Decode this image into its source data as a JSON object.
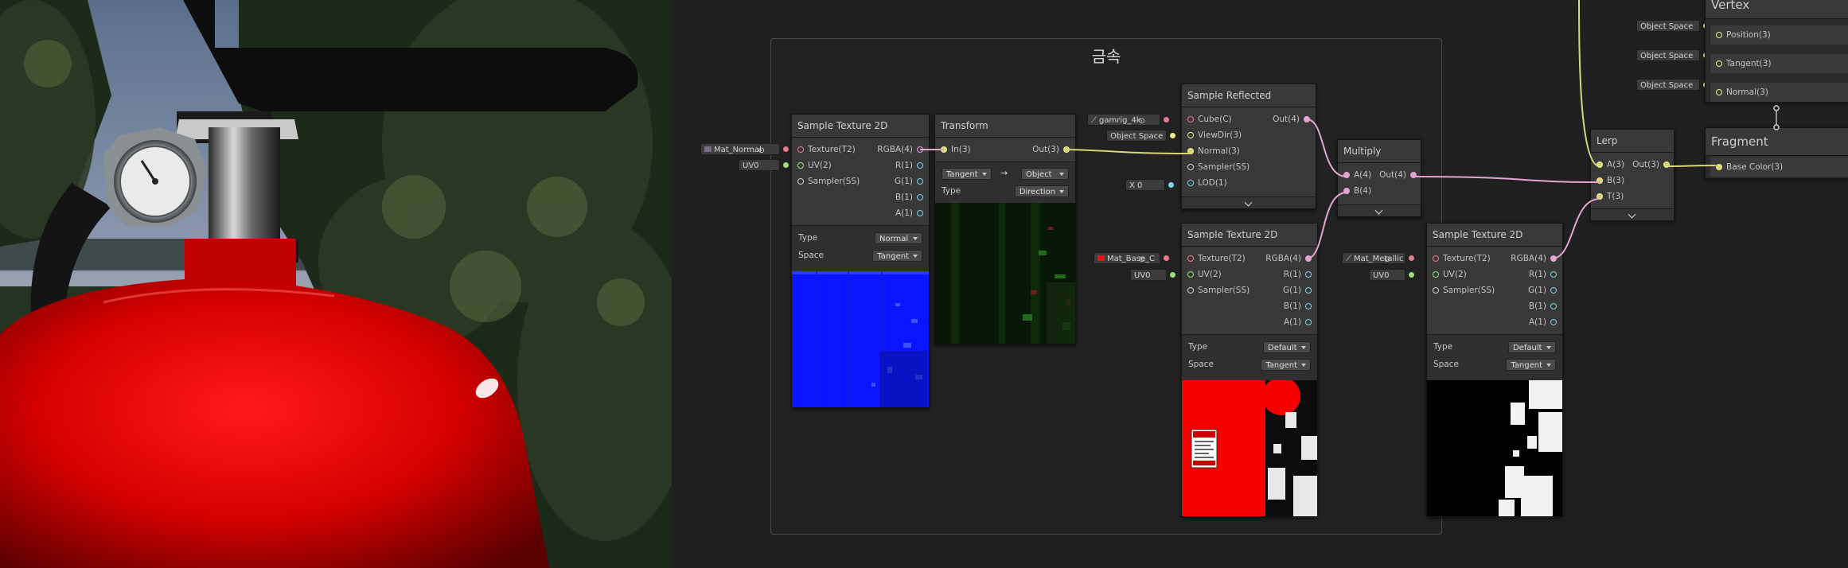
{
  "group": {
    "title": "금속"
  },
  "nodes": {
    "sample_normal": {
      "title": "Sample Texture 2D",
      "inputs": [
        "Texture(T2)",
        "UV(2)",
        "Sampler(SS)"
      ],
      "outputs": [
        "RGBA(4)",
        "R(1)",
        "G(1)",
        "B(1)",
        "A(1)"
      ],
      "type_label": "Type",
      "type_value": "Normal",
      "space_label": "Space",
      "space_value": "Tangent",
      "texture_field": "Mat_Normal",
      "uv_field": "UV0"
    },
    "transform": {
      "title": "Transform",
      "input": "In(3)",
      "output": "Out(3)",
      "from": "Tangent",
      "arrow": "→",
      "to": "Object",
      "type_label": "Type",
      "type_value": "Direction"
    },
    "cubemap": {
      "title": "Sample Reflected Cubemap",
      "inputs": [
        "Cube(C)",
        "ViewDir(3)",
        "Normal(3)",
        "Sampler(SS)",
        "LOD(1)"
      ],
      "output": "Out(4)",
      "cube_field": "gamrig_4k",
      "viewdir_field": "Object Space",
      "lod_axis": "X",
      "lod_value": "0"
    },
    "sample_base": {
      "title": "Sample Texture 2D",
      "inputs": [
        "Texture(T2)",
        "UV(2)",
        "Sampler(SS)"
      ],
      "outputs": [
        "RGBA(4)",
        "R(1)",
        "G(1)",
        "B(1)",
        "A(1)"
      ],
      "type_label": "Type",
      "type_value": "Default",
      "space_label": "Space",
      "space_value": "Tangent",
      "texture_field": "Mat_Base_C",
      "uv_field": "UV0"
    },
    "multiply": {
      "title": "Multiply",
      "inputs": [
        "A(4)",
        "B(4)"
      ],
      "output": "Out(4)"
    },
    "sample_metallic": {
      "title": "Sample Texture 2D",
      "inputs": [
        "Texture(T2)",
        "UV(2)",
        "Sampler(SS)"
      ],
      "outputs": [
        "RGBA(4)",
        "R(1)",
        "G(1)",
        "B(1)",
        "A(1)"
      ],
      "type_label": "Type",
      "type_value": "Default",
      "space_label": "Space",
      "space_value": "Tangent",
      "texture_field": "Mat_Metallic",
      "uv_field": "UV0"
    },
    "lerp": {
      "title": "Lerp",
      "inputs": [
        "A(3)",
        "B(3)",
        "T(3)"
      ],
      "output": "Out(3)"
    }
  },
  "master": {
    "vertex_title": "Vertex",
    "vertex_ports": [
      "Position(3)",
      "Tangent(3)",
      "Normal(3)"
    ],
    "vertex_fields": [
      "Object Space",
      "Object Space",
      "Object Space"
    ],
    "fragment_title": "Fragment",
    "fragment_ports": [
      "Base Color(3)"
    ]
  },
  "colors": {
    "wire_vec3": "#d6d67c",
    "wire_vec4": "#e3a6cf",
    "wire_vec2": "#a5e28c",
    "wire_tex": "#e57f90",
    "wire_float": "#86d8e8",
    "port_float": "#7fd6e6",
    "background": "#202020",
    "node_body": "#383838"
  }
}
